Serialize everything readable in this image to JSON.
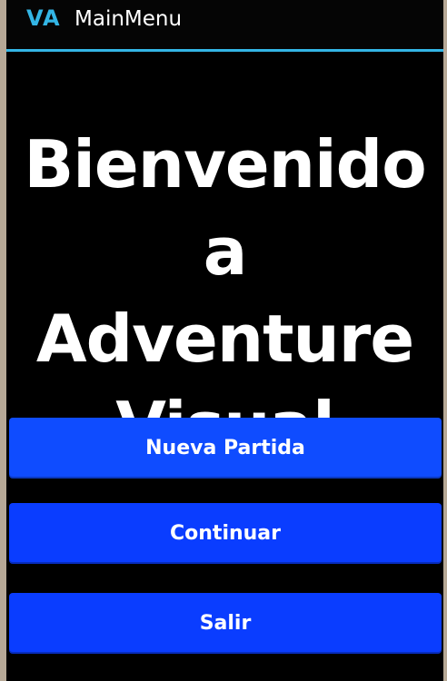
{
  "action_bar": {
    "icon_text": "VA",
    "title": "MainMenu"
  },
  "main": {
    "welcome_line_1": "Bienvenido a",
    "welcome_line_2": "Adventure",
    "welcome_line_3": "Visual"
  },
  "buttons": {
    "new_game_label": "Nueva Partida",
    "continue_label": "Continuar",
    "exit_label": "Salir"
  },
  "colors": {
    "accent": "#33b5e5",
    "button": "#0a3dff",
    "background": "#000000",
    "frame": "#b6a896"
  }
}
